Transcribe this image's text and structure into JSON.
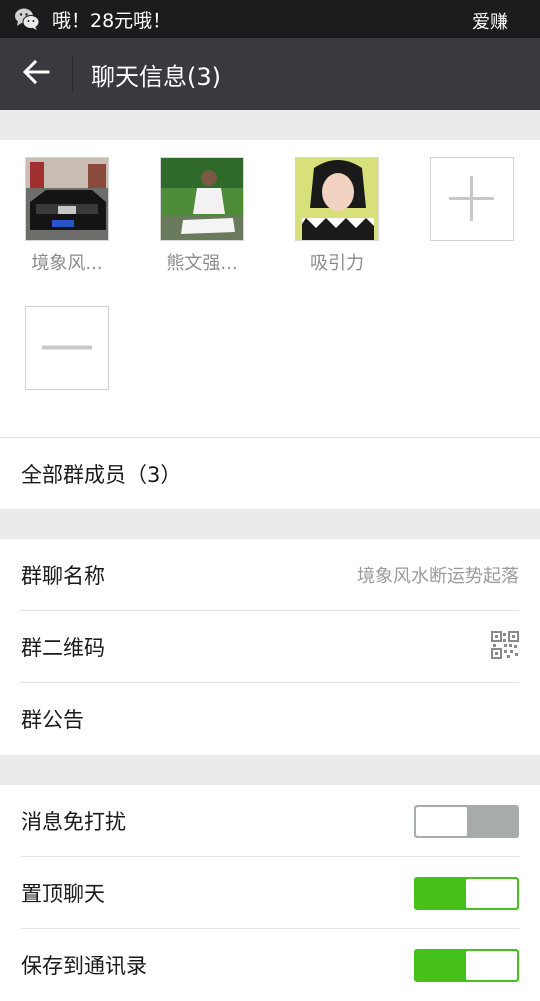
{
  "status_bar": {
    "notification": "哦！28元哦！",
    "carrier": "爱赚"
  },
  "title_bar": {
    "title": "聊天信息(3)"
  },
  "members": [
    {
      "name": "境象风..."
    },
    {
      "name": "熊文强..."
    },
    {
      "name": "吸引力"
    }
  ],
  "all_members": {
    "label": "全部群成员（3）"
  },
  "group": {
    "name_label": "群聊名称",
    "name_value": "境象风水断运势起落",
    "qr_label": "群二维码",
    "notice_label": "群公告"
  },
  "settings": {
    "mute_label": "消息免打扰",
    "mute_on": false,
    "pin_label": "置顶聊天",
    "pin_on": true,
    "save_label": "保存到通讯录",
    "save_on": true
  },
  "colors": {
    "accent_green": "#46c01b",
    "title_bar": "#393a3f",
    "status_bar": "#1b1c1e"
  }
}
